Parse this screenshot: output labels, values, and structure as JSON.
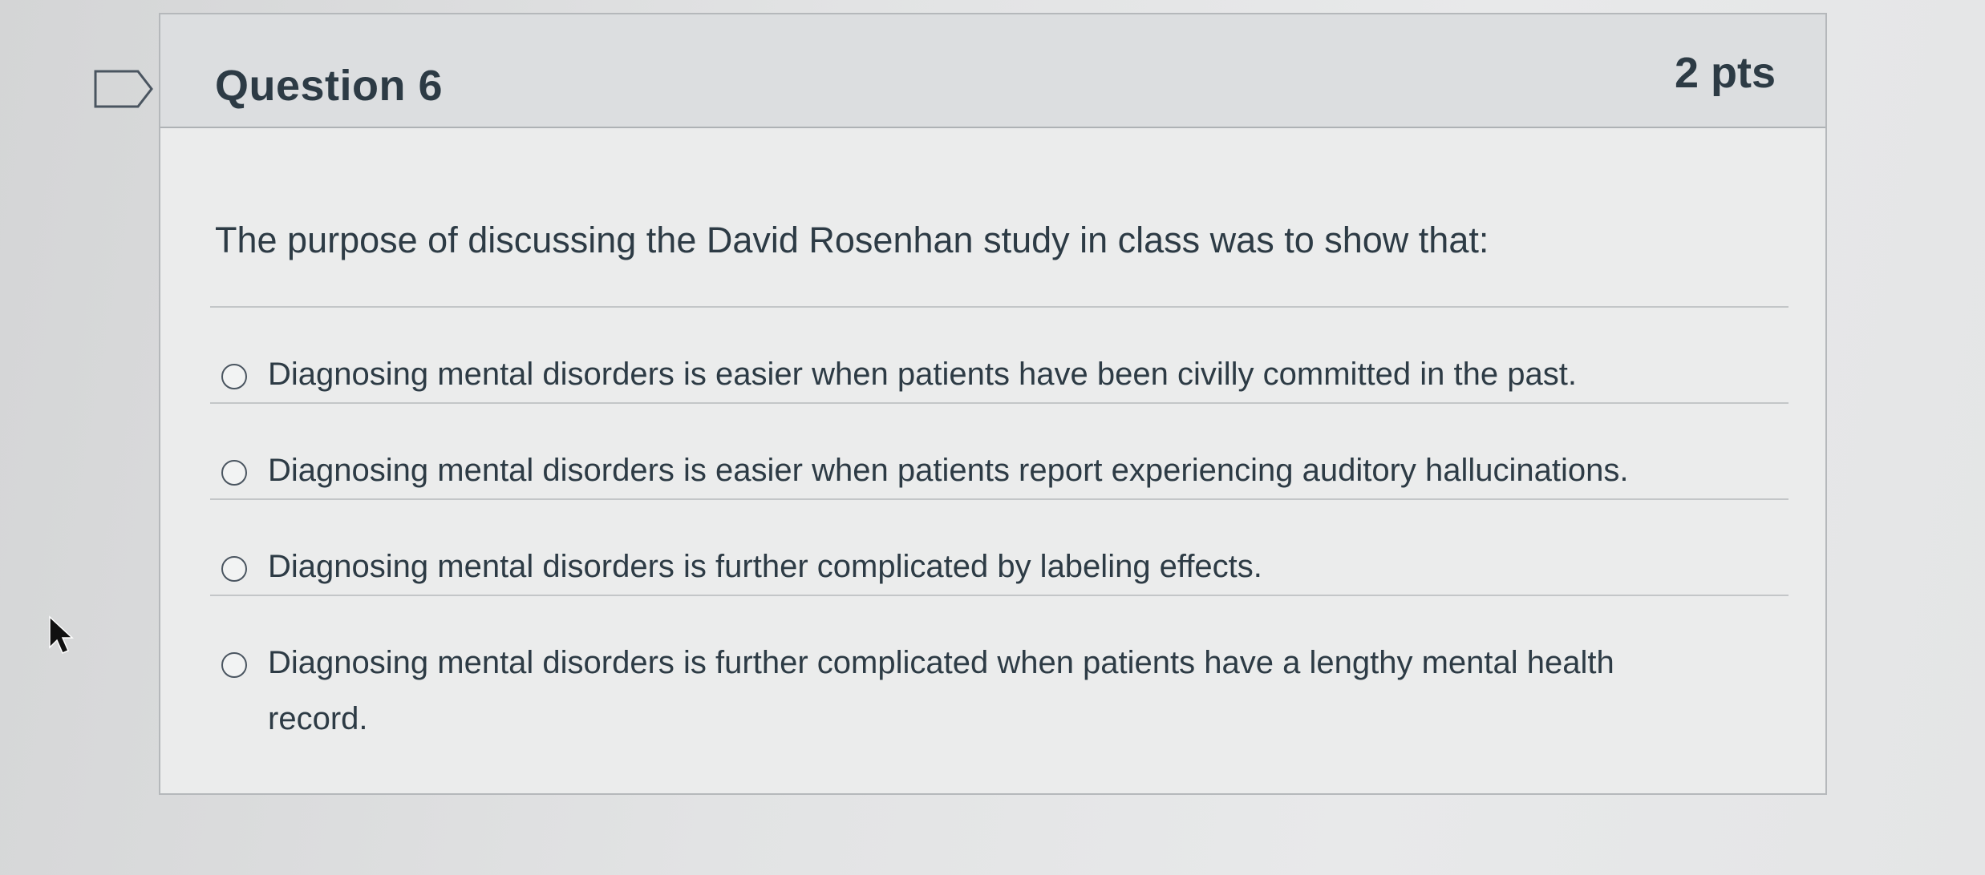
{
  "question": {
    "title": "Question 6",
    "points": "2 pts",
    "prompt": "The purpose of discussing the David Rosenhan study in class was to show that:"
  },
  "answers": [
    {
      "label": "Diagnosing mental disorders is easier when patients have been civilly committed in the past.",
      "selected": false
    },
    {
      "label": "Diagnosing mental disorders is easier when patients report experiencing auditory hallucinations.",
      "selected": false
    },
    {
      "label": "Diagnosing mental disorders is further complicated by labeling effects.",
      "selected": false
    },
    {
      "label": "Diagnosing mental disorders is further complicated when patients have a lengthy mental health record.",
      "selected": false
    }
  ],
  "icons": {
    "flag": "flag-outline-icon",
    "cursor": "mouse-pointer-icon"
  },
  "colors": {
    "text": "#2d3b45",
    "header_bg": "#dcdee0",
    "card_bg": "#ebecec",
    "border": "#b5b8bb"
  }
}
